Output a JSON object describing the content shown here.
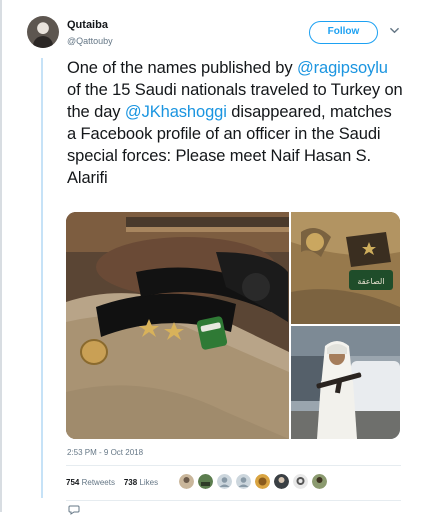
{
  "tweet": {
    "display_name": "Qutaiba",
    "handle": "@Qattouby",
    "follow_label": "Follow",
    "text_parts": {
      "p1": "One of the names published by ",
      "m1": "@ragipsoylu",
      "p2": " of the 15 Saudi nationals traveled to Turkey on the day ",
      "m2": "@JKhashoggi",
      "p3": " disappeared, matches a Facebook profile of an officer in the Saudi special forces: Please meet Naif Hasan S. Alarifi"
    },
    "timestamp": "2:53 PM - 9 Oct 2018",
    "retweets_count": "754",
    "retweets_label": "Retweets",
    "likes_count": "738",
    "likes_label": "Likes"
  },
  "media": {
    "badge_text": "الصاعقة"
  },
  "icons": {
    "chevron": "chevron-down-icon",
    "reply": "reply-icon"
  },
  "colors": {
    "accent": "#1da1f2",
    "link": "#1b95e0",
    "text": "#14171a",
    "secondary": "#657786",
    "thread": "#c6e2f7"
  }
}
